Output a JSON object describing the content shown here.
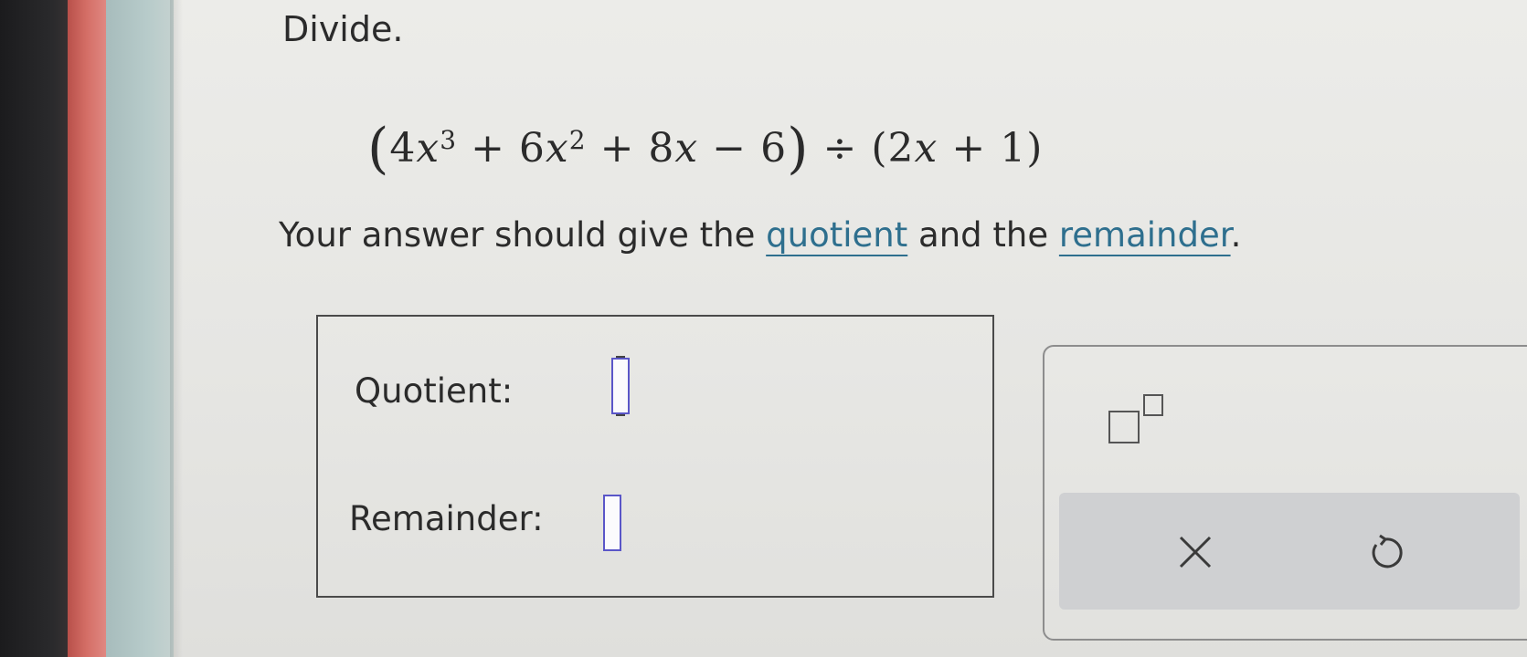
{
  "problem": {
    "instruction": "Divide.",
    "expression": {
      "open1": "(",
      "term1_coef": "4",
      "term1_var": "x",
      "term1_exp": "3",
      "op1": " + 6",
      "term2_var": "x",
      "term2_exp": "2",
      "op2": " + 8",
      "term3_var": "x",
      "term4": " − 6",
      "close1": ")",
      "divide": " ÷ ",
      "open2": "(",
      "div_coef": "2",
      "div_var": "x",
      "div_rest": " + 1",
      "close2": ")"
    },
    "task_prefix": "Your answer should give the ",
    "task_quotient": "quotient",
    "task_middle": " and the ",
    "task_remainder": "remainder",
    "task_suffix": "."
  },
  "answer": {
    "quotient_label": "Quotient:",
    "remainder_label": "Remainder:",
    "quotient_value": "",
    "remainder_value": ""
  },
  "tools": {
    "exponent_icon": "superscript-template-icon",
    "clear_icon": "close-icon",
    "undo_icon": "undo-icon"
  },
  "colors": {
    "link": "#2e6f8e",
    "input_border": "#5a56c8",
    "tool_bar": "#cfd0d2"
  }
}
